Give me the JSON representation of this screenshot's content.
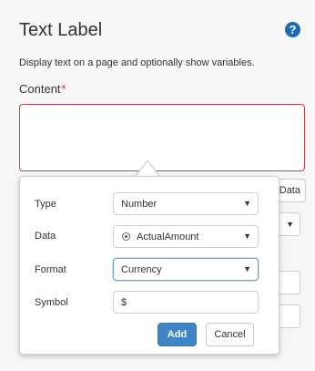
{
  "panel": {
    "title": "Text Label",
    "help_icon": "?",
    "description": "Display text on a page and optionally show variables.",
    "content_label": "Content",
    "required_marker": "*"
  },
  "background_controls": {
    "data_button_label": "Data"
  },
  "popup": {
    "type_label": "Type",
    "type_value": "Number",
    "data_label": "Data",
    "data_value": "ActualAmount",
    "format_label": "Format",
    "format_value": "Currency",
    "symbol_label": "Symbol",
    "symbol_value": "$",
    "add_label": "Add",
    "cancel_label": "Cancel"
  },
  "icons": {
    "dropdown_arrow": "▼",
    "variable": "variable-icon",
    "help": "help-icon"
  },
  "colors": {
    "accent": "#3d85c6",
    "required": "#c9302c",
    "error_border": "#b9454a",
    "help_icon": "#1f6bb3"
  }
}
